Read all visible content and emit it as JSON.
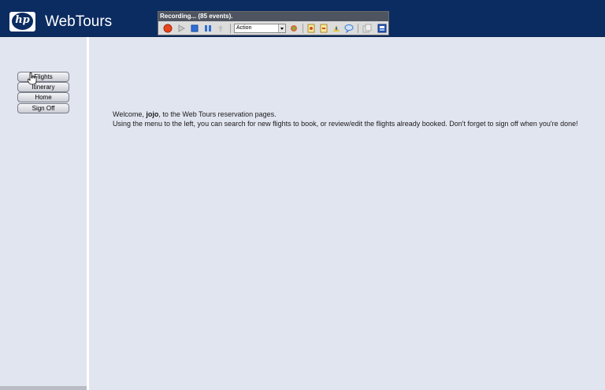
{
  "header": {
    "logo_text": "hp",
    "app_name": "WebTours"
  },
  "recorder": {
    "title": "Recording... (85 events).",
    "section_value": "Action",
    "toolbar_icons": [
      "record-icon",
      "play-icon",
      "stop-icon",
      "pause-icon",
      "insert-icon",
      "insert-action-icon",
      "new-action-icon",
      "start-transaction-icon",
      "end-transaction-icon",
      "rendezvous-icon",
      "comment-icon",
      "copy-icon",
      "settings-icon"
    ]
  },
  "nav": {
    "items": [
      {
        "label": "Flights"
      },
      {
        "label": "Itinerary"
      },
      {
        "label": "Home"
      },
      {
        "label": "Sign Off"
      }
    ]
  },
  "main": {
    "welcome_prefix": "Welcome, ",
    "username": "jojo",
    "welcome_suffix": ", to the Web Tours reservation pages.",
    "instructions": "Using the menu to the left, you can search for new flights to book, or review/edit the flights already booked. Don't forget to sign off when you're done!"
  },
  "colors": {
    "header_bg": "#0b2c61",
    "page_bg": "#e1e5f0",
    "recorder_title_bg": "#4f5560"
  }
}
